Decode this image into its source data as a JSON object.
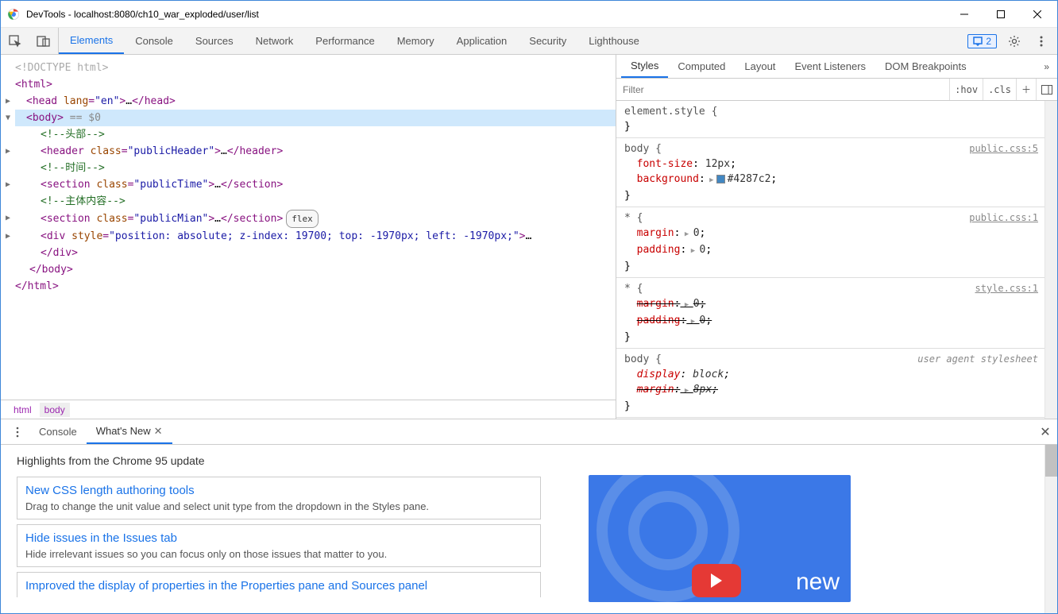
{
  "window": {
    "title": "DevTools - localhost:8080/ch10_war_exploded/user/list"
  },
  "toolbar": {
    "tabs": [
      "Elements",
      "Console",
      "Sources",
      "Network",
      "Performance",
      "Memory",
      "Application",
      "Security",
      "Lighthouse"
    ],
    "activeIndex": 0,
    "issuesBadge": "2"
  },
  "dom": {
    "doctype": "<!DOCTYPE html>",
    "htmlOpen": "<html>",
    "headLine": {
      "before": "<head ",
      "attrName": "lang",
      "attrVal": "\"en\"",
      "after": ">…</head>"
    },
    "bodyOpen": "<body>",
    "selVar": " == $0",
    "comment1": "<!--头部-->",
    "headerLine": {
      "before": "<header ",
      "attrName": "class",
      "attrVal": "\"publicHeader\"",
      "after": ">…</header>"
    },
    "comment2": "<!--时间-->",
    "section1": {
      "before": "<section ",
      "attrName": "class",
      "attrVal": "\"publicTime\"",
      "after": ">…</section>"
    },
    "comment3": "<!--主体内容-->",
    "section2": {
      "before": "<section ",
      "attrName": "class",
      "attrVal": "\"publicMian\"",
      "after": ">…</section>",
      "badge": "flex"
    },
    "divLine": {
      "before": "<div ",
      "attrName": "style",
      "attrVal": "\"position: absolute; z-index: 19700; top: -1970px; left: -1970px;\"",
      "after": ">…"
    },
    "divClose": "</div>",
    "bodyClose": "</body>",
    "htmlClose": "</html>"
  },
  "crumbs": [
    "html",
    "body"
  ],
  "stylesTabs": [
    "Styles",
    "Computed",
    "Layout",
    "Event Listeners",
    "DOM Breakpoints"
  ],
  "filter": {
    "placeholder": "Filter",
    "hov": ":hov",
    "cls": ".cls"
  },
  "rules": {
    "r0": {
      "sel": "element.style {",
      "close": "}"
    },
    "r1": {
      "sel": "body {",
      "src": "public.css:5",
      "p1": "font-size",
      "v1": "12px",
      "p2": "background",
      "v2": "#4287c2",
      "close": "}"
    },
    "r2": {
      "sel": "* {",
      "src": "public.css:1",
      "p1": "margin",
      "v1": "0",
      "p2": "padding",
      "v2": "0",
      "close": "}"
    },
    "r3": {
      "sel": "* {",
      "src": "style.css:1",
      "p1": "margin",
      "v1": "0",
      "p2": "padding",
      "v2": "0",
      "close": "}"
    },
    "r4": {
      "sel": "body {",
      "src": "user agent stylesheet",
      "p1": "display",
      "v1": "block",
      "p2": "margin",
      "v2": "8px",
      "close": "}"
    }
  },
  "drawer": {
    "tabs": {
      "console": "Console",
      "whatsnew": "What's New"
    },
    "heading": "Highlights from the Chrome 95 update",
    "cards": [
      {
        "title": "New CSS length authoring tools",
        "desc": "Drag to change the unit value and select unit type from the dropdown in the Styles pane."
      },
      {
        "title": "Hide issues in the Issues tab",
        "desc": "Hide irrelevant issues so you can focus only on those issues that matter to you."
      },
      {
        "title": "Improved the display of properties in the Properties pane and Sources panel",
        "desc": ""
      }
    ],
    "promoText": "new"
  }
}
